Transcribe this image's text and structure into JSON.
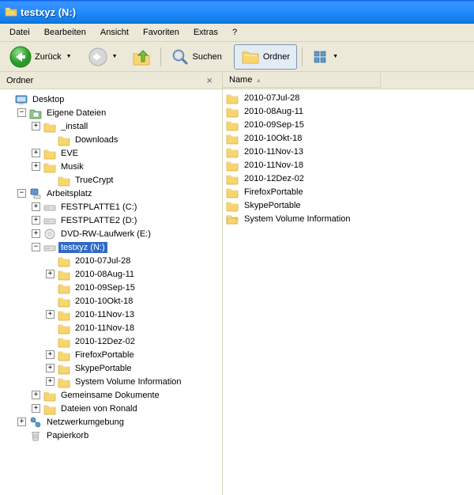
{
  "window": {
    "title": "testxyz (N:)"
  },
  "menu": {
    "items": [
      "Datei",
      "Bearbeiten",
      "Ansicht",
      "Favoriten",
      "Extras",
      "?"
    ]
  },
  "toolbar": {
    "back": "Zurück",
    "search": "Suchen",
    "folders": "Ordner"
  },
  "panes": {
    "tree_title": "Ordner",
    "list_col_name": "Name"
  },
  "tree": [
    {
      "d": 0,
      "exp": " ",
      "icon": "desktop",
      "label": "Desktop"
    },
    {
      "d": 1,
      "exp": "-",
      "icon": "mydoc",
      "label": "Eigene Dateien"
    },
    {
      "d": 2,
      "exp": "+",
      "icon": "folder",
      "label": "_install"
    },
    {
      "d": 3,
      "exp": " ",
      "icon": "folder",
      "label": "Downloads"
    },
    {
      "d": 2,
      "exp": "+",
      "icon": "folder",
      "label": "EVE"
    },
    {
      "d": 2,
      "exp": "+",
      "icon": "folder",
      "label": "Musik"
    },
    {
      "d": 3,
      "exp": " ",
      "icon": "folder",
      "label": "TrueCrypt"
    },
    {
      "d": 1,
      "exp": "-",
      "icon": "mypc",
      "label": "Arbeitsplatz"
    },
    {
      "d": 2,
      "exp": "+",
      "icon": "drive",
      "label": "FESTPLATTE1 (C:)"
    },
    {
      "d": 2,
      "exp": "+",
      "icon": "drive",
      "label": "FESTPLATTE2 (D:)"
    },
    {
      "d": 2,
      "exp": "+",
      "icon": "dvd",
      "label": "DVD-RW-Laufwerk (E:)"
    },
    {
      "d": 2,
      "exp": "-",
      "icon": "drive",
      "label": "testxyz (N:)",
      "selected": true
    },
    {
      "d": 3,
      "exp": " ",
      "icon": "folder",
      "label": "2010-07Jul-28"
    },
    {
      "d": 3,
      "exp": "+",
      "icon": "folder",
      "label": "2010-08Aug-11"
    },
    {
      "d": 3,
      "exp": " ",
      "icon": "folder",
      "label": "2010-09Sep-15"
    },
    {
      "d": 3,
      "exp": " ",
      "icon": "folder",
      "label": "2010-10Okt-18"
    },
    {
      "d": 3,
      "exp": "+",
      "icon": "folder",
      "label": "2010-11Nov-13"
    },
    {
      "d": 3,
      "exp": " ",
      "icon": "folder",
      "label": "2010-11Nov-18"
    },
    {
      "d": 3,
      "exp": " ",
      "icon": "folder",
      "label": "2010-12Dez-02"
    },
    {
      "d": 3,
      "exp": "+",
      "icon": "folder",
      "label": "FirefoxPortable"
    },
    {
      "d": 3,
      "exp": "+",
      "icon": "folder",
      "label": "SkypePortable"
    },
    {
      "d": 3,
      "exp": "+",
      "icon": "folder",
      "label": "System Volume Information"
    },
    {
      "d": 2,
      "exp": "+",
      "icon": "folder",
      "label": "Gemeinsame Dokumente"
    },
    {
      "d": 2,
      "exp": "+",
      "icon": "folder",
      "label": "Dateien von Ronald"
    },
    {
      "d": 1,
      "exp": "+",
      "icon": "network",
      "label": "Netzwerkumgebung"
    },
    {
      "d": 1,
      "exp": " ",
      "icon": "bin",
      "label": "Papierkorb"
    }
  ],
  "list": [
    {
      "icon": "folder",
      "name": "2010-07Jul-28"
    },
    {
      "icon": "folder",
      "name": "2010-08Aug-11"
    },
    {
      "icon": "folder",
      "name": "2010-09Sep-15"
    },
    {
      "icon": "folder",
      "name": "2010-10Okt-18"
    },
    {
      "icon": "folder",
      "name": "2010-11Nov-13"
    },
    {
      "icon": "folder",
      "name": "2010-11Nov-18"
    },
    {
      "icon": "folder",
      "name": "2010-12Dez-02"
    },
    {
      "icon": "folder",
      "name": "FirefoxPortable"
    },
    {
      "icon": "folder",
      "name": "SkypePortable"
    },
    {
      "icon": "folder-open",
      "name": "System Volume Information"
    }
  ]
}
